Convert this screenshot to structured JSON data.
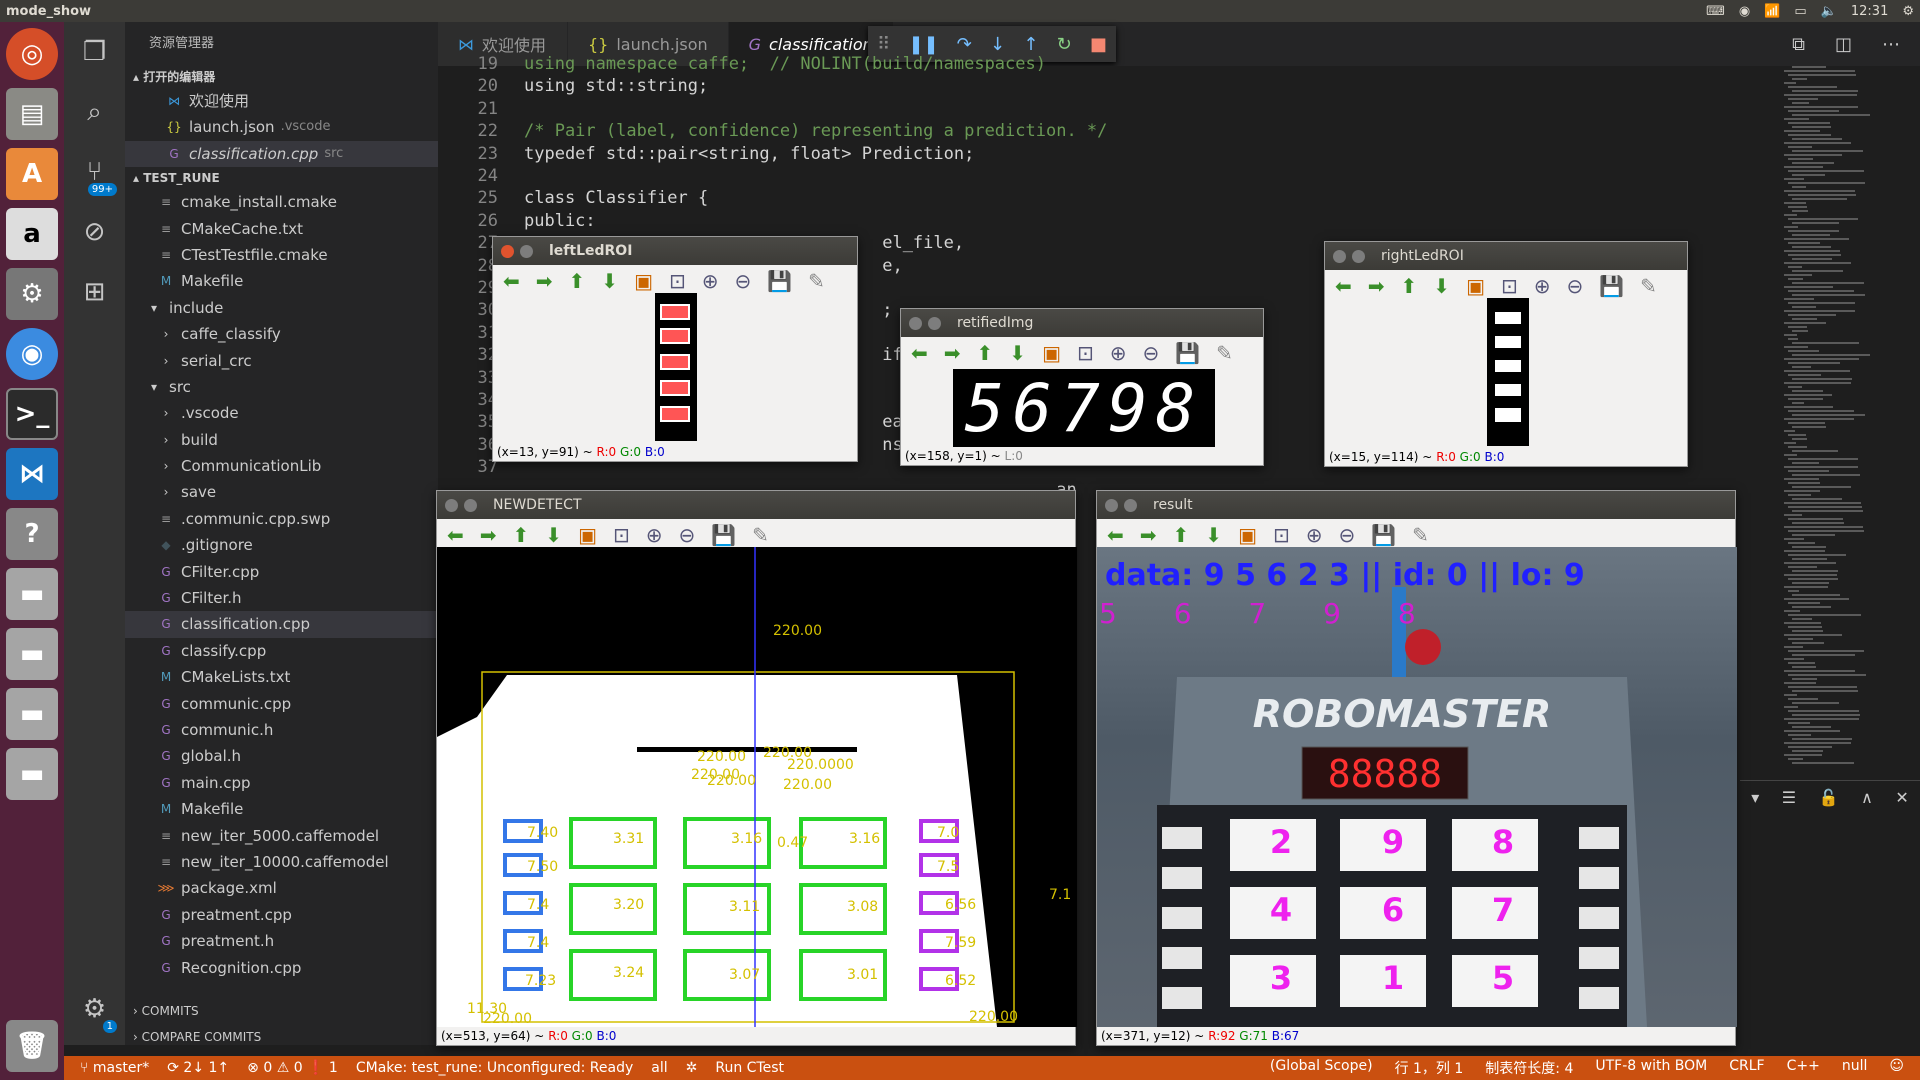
{
  "topbar": {
    "title": "mode_show",
    "time": "12:31"
  },
  "launcher": {
    "items": [
      "ubuntu-icon",
      "files-icon",
      "software-icon",
      "amazon-icon",
      "settings-icon",
      "chrome-icon",
      "terminal-icon",
      "vscode-icon",
      "help-icon",
      "drive-icon",
      "drive-icon",
      "drive-icon",
      "drive-icon",
      "trash-icon"
    ]
  },
  "activity": {
    "scm_badge": "99+",
    "settings_badge": "1"
  },
  "sidebar": {
    "header": "资源管理器",
    "open_editors_title": "打开的编辑器",
    "open_editors": [
      {
        "label": "欢迎使用",
        "desc": ""
      },
      {
        "label": "launch.json",
        "desc": ".vscode"
      },
      {
        "label": "classification.cpp",
        "desc": "src"
      }
    ],
    "project_title": "TEST_RUNE",
    "files": [
      {
        "label": "cmake_install.cmake",
        "indent": 1,
        "icon": "≡"
      },
      {
        "label": "CMakeCache.txt",
        "indent": 1,
        "icon": "≡"
      },
      {
        "label": "CTestTestfile.cmake",
        "indent": 1,
        "icon": "≡"
      },
      {
        "label": "Makefile",
        "indent": 1,
        "icon": "M"
      },
      {
        "label": "include",
        "indent": 0,
        "icon": "▾"
      },
      {
        "label": "caffe_classify",
        "indent": 1,
        "icon": "›"
      },
      {
        "label": "serial_crc",
        "indent": 1,
        "icon": "›"
      },
      {
        "label": "src",
        "indent": 0,
        "icon": "▾"
      },
      {
        "label": ".vscode",
        "indent": 1,
        "icon": "›"
      },
      {
        "label": "build",
        "indent": 1,
        "icon": "›"
      },
      {
        "label": "CommunicationLib",
        "indent": 1,
        "icon": "›"
      },
      {
        "label": "save",
        "indent": 1,
        "icon": "›"
      },
      {
        "label": ".communic.cpp.swp",
        "indent": 1,
        "icon": "≡"
      },
      {
        "label": ".gitignore",
        "indent": 1,
        "icon": "◆"
      },
      {
        "label": "CFilter.cpp",
        "indent": 1,
        "icon": "G"
      },
      {
        "label": "CFilter.h",
        "indent": 1,
        "icon": "G"
      },
      {
        "label": "classification.cpp",
        "indent": 1,
        "icon": "G"
      },
      {
        "label": "classify.cpp",
        "indent": 1,
        "icon": "G"
      },
      {
        "label": "CMakeLists.txt",
        "indent": 1,
        "icon": "M"
      },
      {
        "label": "communic.cpp",
        "indent": 1,
        "icon": "G"
      },
      {
        "label": "communic.h",
        "indent": 1,
        "icon": "G"
      },
      {
        "label": "global.h",
        "indent": 1,
        "icon": "G"
      },
      {
        "label": "main.cpp",
        "indent": 1,
        "icon": "G"
      },
      {
        "label": "Makefile",
        "indent": 1,
        "icon": "M"
      },
      {
        "label": "new_iter_5000.caffemodel",
        "indent": 1,
        "icon": "≡"
      },
      {
        "label": "new_iter_10000.caffemodel",
        "indent": 1,
        "icon": "≡"
      },
      {
        "label": "package.xml",
        "indent": 1,
        "icon": "⋙"
      },
      {
        "label": "preatment.cpp",
        "indent": 1,
        "icon": "G"
      },
      {
        "label": "preatment.h",
        "indent": 1,
        "icon": "G"
      },
      {
        "label": "Recognition.cpp",
        "indent": 1,
        "icon": "G"
      }
    ],
    "selected_file": "classification.cpp",
    "commits": "COMMITS",
    "compare": "COMPARE COMMITS"
  },
  "tabs": [
    {
      "label": "欢迎使用",
      "icon": "vscode-icon"
    },
    {
      "label": "launch.json",
      "icon": "json-icon"
    },
    {
      "label": "classification",
      "icon": "cpp-icon"
    }
  ],
  "editor": {
    "lines": [
      {
        "n": "19",
        "t": "using namespace caffe;  // NOLINT(build/namespaces)"
      },
      {
        "n": "20",
        "t": "using std::string;"
      },
      {
        "n": "21",
        "t": ""
      },
      {
        "n": "22",
        "t": "/* Pair (label, confidence) representing a prediction. */"
      },
      {
        "n": "23",
        "t": "typedef std::pair<string, float> Prediction;"
      },
      {
        "n": "24",
        "t": ""
      },
      {
        "n": "25",
        "t": "class Classifier {"
      },
      {
        "n": "26",
        "t": "public:"
      },
      {
        "n": "27",
        "t": "                                   el_file,"
      },
      {
        "n": "28",
        "t": "                                   e,"
      },
      {
        "n": "29",
        "t": ""
      },
      {
        "n": "30",
        "t": "                                   ;"
      },
      {
        "n": "31",
        "t": ""
      },
      {
        "n": "32",
        "t": "                                   ify("
      },
      {
        "n": "33",
        "t": ""
      },
      {
        "n": "34",
        "t": ""
      },
      {
        "n": "35",
        "t": "                                   ean_f"
      },
      {
        "n": "36",
        "t": "                                   nst"
      },
      {
        "n": "37",
        "t": ""
      },
      {
        "n": "",
        "t": "                                                    an"
      }
    ]
  },
  "windows": {
    "left": {
      "title": "leftLedROI",
      "status_pos": "(x=13, y=91) ~",
      "r": "R:0",
      "g": "G:0",
      "b": "B:0"
    },
    "retified": {
      "title": "retifiedImg",
      "digits": "56798",
      "status_pos": "(x=158, y=1) ~",
      "l": "L:0"
    },
    "right": {
      "title": "rightLedROI",
      "status_pos": "(x=15, y=114) ~",
      "r": "R:0",
      "g": "G:0",
      "b": "B:0"
    },
    "newdetect": {
      "title": "NEWDETECT",
      "status_pos": "(x=513, y=64) ~",
      "r": "R:0",
      "g": "G:0",
      "b": "B:0",
      "labels": [
        "220.00",
        "220.00",
        "220.00",
        "220.0000",
        "220.00",
        "220.00",
        "220.00",
        "3.31",
        "3.16",
        "0.47",
        "3.16",
        "3.20",
        "3.11",
        "3.08",
        "3.24",
        "3.07",
        "3.01",
        "7.40",
        "7.50",
        "7.4",
        "7.4",
        "7.23",
        "7.0",
        "7.5",
        "6.56",
        "7.59",
        "6.52",
        "7.1",
        "220.00",
        "11.30",
        "220.00"
      ]
    },
    "result": {
      "title": "result",
      "data_line": "data: 9 5 6 2 3 || id: 0 || lo: 9",
      "digits_line": "5 6 7 9 8",
      "brand": "ROBOMASTER",
      "led": "88888",
      "grid": [
        "2",
        "9",
        "8",
        "4",
        "6",
        "7",
        "3",
        "1",
        "5"
      ],
      "status_pos": "(x=371, y=12) ~",
      "r": "R:92",
      "g": "G:71",
      "b": "B:67"
    }
  },
  "statusbar": {
    "branch": "master*",
    "sync": "2↓ 1↑",
    "problems": "⊗ 0 ⚠ 0 ❗ 1",
    "cmake": "CMake: test_rune: Unconfigured: Ready",
    "target": "all",
    "ctest": "Run CTest",
    "scope": "(Global Scope)",
    "position": "行 1，列 1",
    "tab": "制表符长度: 4",
    "encoding": "UTF-8 with BOM",
    "eol": "CRLF",
    "lang": "C++",
    "extra": "null"
  },
  "colors": {
    "accent": "#ca5010",
    "launcher": "#52213a",
    "editor": "#1e1e1e"
  }
}
